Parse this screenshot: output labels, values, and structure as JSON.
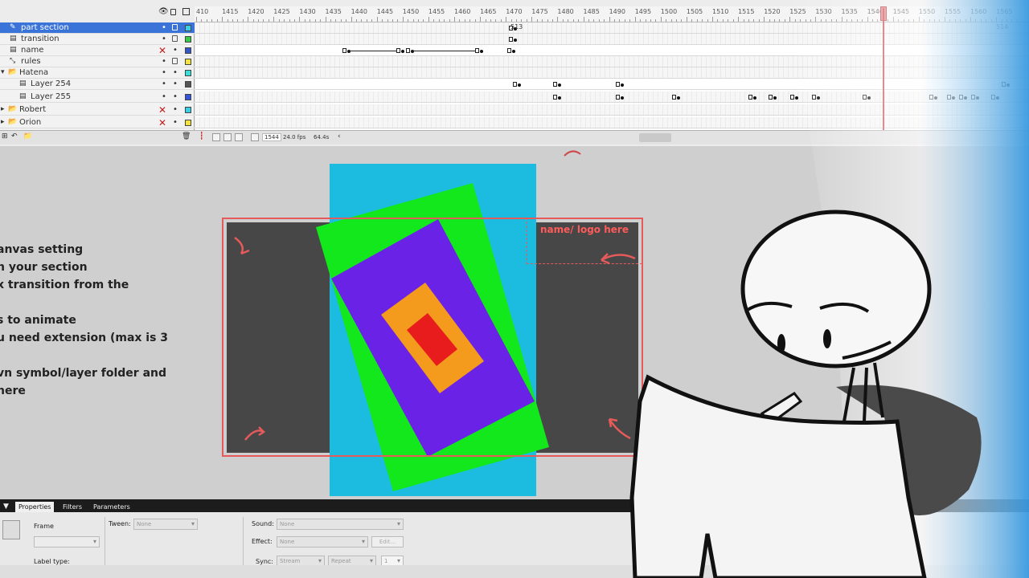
{
  "timeline": {
    "ruler_ticks": [
      "410",
      "1415",
      "1420",
      "1425",
      "1430",
      "1435",
      "1440",
      "1445",
      "1450",
      "1455",
      "1460",
      "1465",
      "1470",
      "1475",
      "1480",
      "1485",
      "1490",
      "1495",
      "1500",
      "1505",
      "1510",
      "1515",
      "1520",
      "1525",
      "1530",
      "1535",
      "1540",
      "1545",
      "1550",
      "1555",
      "1560",
      "1565"
    ],
    "frame_marker_513": "513",
    "frame_marker_514": "514",
    "layers": [
      {
        "name": "part section",
        "icon": "pencil",
        "selected": true,
        "indent": 2,
        "swatch": "#35d0e8",
        "has_x": false
      },
      {
        "name": "transition",
        "icon": "layer",
        "selected": false,
        "indent": 2,
        "swatch": "#33cc44",
        "has_x": false
      },
      {
        "name": "name",
        "icon": "layer",
        "selected": false,
        "indent": 2,
        "swatch": "#3355cc",
        "has_x": true
      },
      {
        "name": "rules",
        "icon": "guide",
        "selected": false,
        "indent": 2,
        "swatch": "#f2e33a",
        "has_x": false
      },
      {
        "name": "Hatena",
        "icon": "folder",
        "selected": false,
        "indent": 0,
        "swatch": "#35e0d8",
        "has_x": false
      },
      {
        "name": "Layer 254",
        "icon": "layer",
        "selected": false,
        "indent": 14,
        "swatch": "#555555",
        "has_x": false
      },
      {
        "name": "Layer 255",
        "icon": "layer",
        "selected": false,
        "indent": 14,
        "swatch": "#3355dd",
        "has_x": false
      },
      {
        "name": "Robert",
        "icon": "folder",
        "selected": false,
        "indent": 0,
        "swatch": "#35d0e8",
        "has_x": true
      },
      {
        "name": "Orion",
        "icon": "folder",
        "selected": false,
        "indent": 0,
        "swatch": "#f2e33a",
        "has_x": true
      }
    ],
    "footer": {
      "current_frame": "1544",
      "fps": "24.0 fps",
      "time": "64.4s"
    }
  },
  "stage": {
    "instructions": [
      "anvas setting",
      "n your section",
      "x transition from the",
      "",
      "s to animate",
      "u need extension (max is 3",
      "",
      "vn symbol/layer folder and",
      "here"
    ],
    "logo_placeholder": "name/ logo here",
    "colors": {
      "backdrop_blue": "#1bbce0",
      "green": "#12e81c",
      "purple": "#6a22e6",
      "orange": "#f49a1c",
      "red": "#e81c1c",
      "dark": "#474747",
      "guide_red": "#e55a5a"
    }
  },
  "properties": {
    "tabs": [
      "Properties",
      "Filters",
      "Parameters"
    ],
    "frame_label": "Frame",
    "tween_label": "Tween:",
    "tween_value": "None",
    "sound_label": "Sound:",
    "sound_value": "None",
    "effect_label": "Effect:",
    "effect_value": "None",
    "edit_button": "Edit...",
    "label_type_label": "Label type:",
    "sync_label": "Sync:",
    "sync_value": "Stream",
    "repeat_value": "Repeat",
    "repeat_count": "1"
  }
}
